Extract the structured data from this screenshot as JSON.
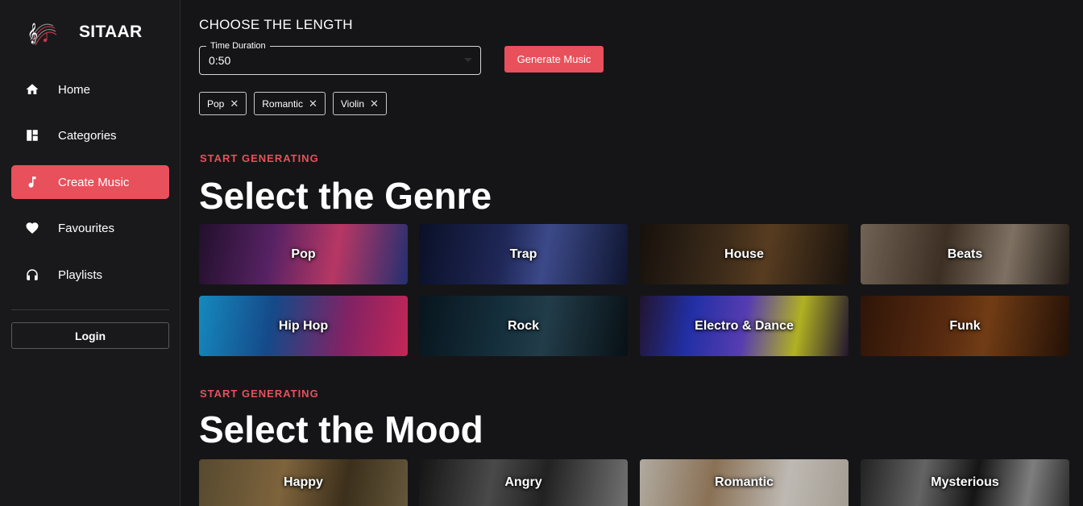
{
  "app": {
    "name": "SITAAR",
    "logo_icon": "music-staff-logo-icon"
  },
  "sidebar": {
    "items": [
      {
        "label": "Home",
        "icon": "home-icon"
      },
      {
        "label": "Categories",
        "icon": "dashboard-icon"
      },
      {
        "label": "Create Music",
        "icon": "music-note-icon",
        "active": true
      },
      {
        "label": "Favourites",
        "icon": "heart-icon"
      },
      {
        "label": "Playlists",
        "icon": "headphones-icon"
      }
    ],
    "login_label": "Login"
  },
  "length": {
    "title": "CHOOSE THE LENGTH",
    "field_label": "Time Duration",
    "field_value": "0:50",
    "generate_label": "Generate Music"
  },
  "chips": [
    "Pop",
    "Romantic",
    "Violin"
  ],
  "genre": {
    "eyebrow": "START GENERATING",
    "title": "Select the Genre",
    "cards": [
      "Pop",
      "Trap",
      "House",
      "Beats",
      "Hip Hop",
      "Rock",
      "Electro & Dance",
      "Funk"
    ]
  },
  "mood": {
    "eyebrow": "START GENERATING",
    "title": "Select the Mood",
    "cards": [
      "Happy",
      "Angry",
      "Romantic",
      "Mysterious"
    ]
  },
  "colors": {
    "accent": "#e8505b",
    "background": "#151517",
    "sidebar": "#19191b"
  }
}
